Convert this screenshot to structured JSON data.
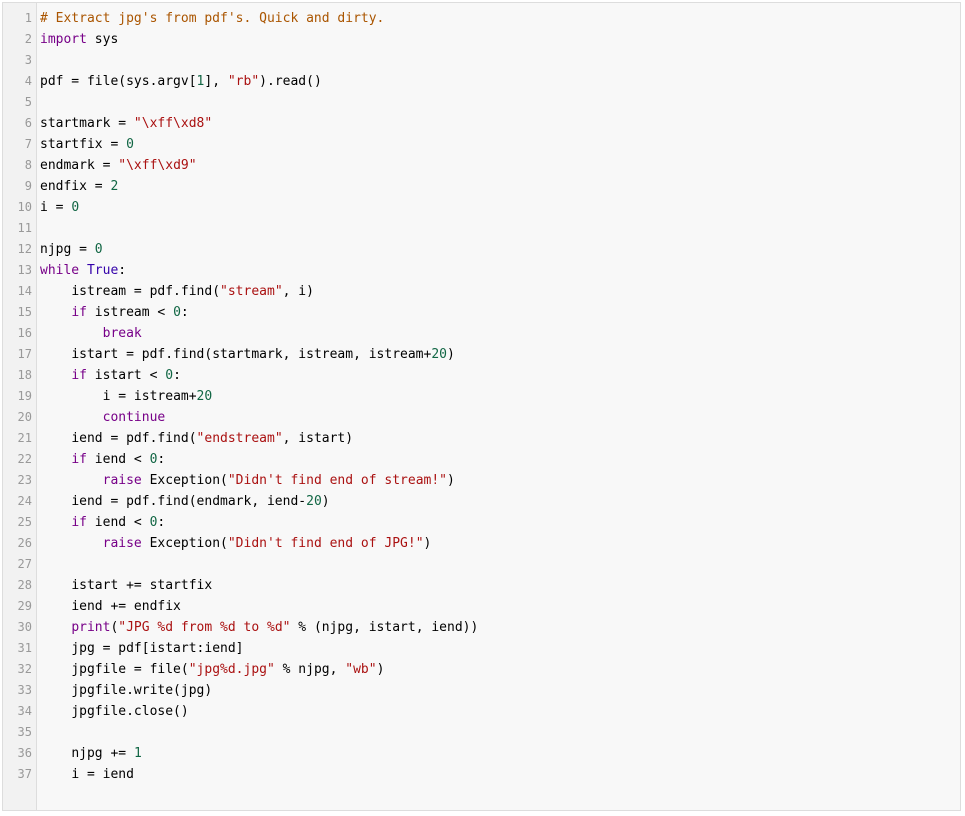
{
  "editor": {
    "colors": {
      "keyword": "#770088",
      "builtin": "#3300aa",
      "string": "#aa1111",
      "number": "#116644",
      "comment": "#aa5500",
      "text": "#000000",
      "line_number": "#999999"
    },
    "lines": [
      {
        "n": "1",
        "tokens": [
          {
            "t": "comment",
            "v": "# Extract jpg's from pdf's. Quick and dirty."
          }
        ]
      },
      {
        "n": "2",
        "tokens": [
          {
            "t": "keyword",
            "v": "import"
          },
          {
            "t": "text",
            "v": " sys"
          }
        ]
      },
      {
        "n": "3",
        "tokens": []
      },
      {
        "n": "4",
        "tokens": [
          {
            "t": "text",
            "v": "pdf = file(sys.argv["
          },
          {
            "t": "number",
            "v": "1"
          },
          {
            "t": "text",
            "v": "], "
          },
          {
            "t": "string",
            "v": "\"rb\""
          },
          {
            "t": "text",
            "v": ").read()"
          }
        ]
      },
      {
        "n": "5",
        "tokens": []
      },
      {
        "n": "6",
        "tokens": [
          {
            "t": "text",
            "v": "startmark = "
          },
          {
            "t": "string",
            "v": "\"\\xff\\xd8\""
          }
        ]
      },
      {
        "n": "7",
        "tokens": [
          {
            "t": "text",
            "v": "startfix = "
          },
          {
            "t": "number",
            "v": "0"
          }
        ]
      },
      {
        "n": "8",
        "tokens": [
          {
            "t": "text",
            "v": "endmark = "
          },
          {
            "t": "string",
            "v": "\"\\xff\\xd9\""
          }
        ]
      },
      {
        "n": "9",
        "tokens": [
          {
            "t": "text",
            "v": "endfix = "
          },
          {
            "t": "number",
            "v": "2"
          }
        ]
      },
      {
        "n": "10",
        "tokens": [
          {
            "t": "text",
            "v": "i = "
          },
          {
            "t": "number",
            "v": "0"
          }
        ]
      },
      {
        "n": "11",
        "tokens": []
      },
      {
        "n": "12",
        "tokens": [
          {
            "t": "text",
            "v": "njpg = "
          },
          {
            "t": "number",
            "v": "0"
          }
        ]
      },
      {
        "n": "13",
        "tokens": [
          {
            "t": "keyword",
            "v": "while"
          },
          {
            "t": "text",
            "v": " "
          },
          {
            "t": "builtin",
            "v": "True"
          },
          {
            "t": "text",
            "v": ":"
          }
        ]
      },
      {
        "n": "14",
        "tokens": [
          {
            "t": "ws",
            "v": "    "
          },
          {
            "t": "text",
            "v": "istream = pdf.find("
          },
          {
            "t": "string",
            "v": "\"stream\""
          },
          {
            "t": "text",
            "v": ", i)"
          }
        ]
      },
      {
        "n": "15",
        "tokens": [
          {
            "t": "ws",
            "v": "    "
          },
          {
            "t": "keyword",
            "v": "if"
          },
          {
            "t": "text",
            "v": " istream < "
          },
          {
            "t": "number",
            "v": "0"
          },
          {
            "t": "text",
            "v": ":"
          }
        ]
      },
      {
        "n": "16",
        "tokens": [
          {
            "t": "ws",
            "v": "        "
          },
          {
            "t": "keyword",
            "v": "break"
          }
        ]
      },
      {
        "n": "17",
        "tokens": [
          {
            "t": "ws",
            "v": "    "
          },
          {
            "t": "text",
            "v": "istart = pdf.find(startmark, istream, istream+"
          },
          {
            "t": "number",
            "v": "20"
          },
          {
            "t": "text",
            "v": ")"
          }
        ]
      },
      {
        "n": "18",
        "tokens": [
          {
            "t": "ws",
            "v": "    "
          },
          {
            "t": "keyword",
            "v": "if"
          },
          {
            "t": "text",
            "v": " istart < "
          },
          {
            "t": "number",
            "v": "0"
          },
          {
            "t": "text",
            "v": ":"
          }
        ]
      },
      {
        "n": "19",
        "tokens": [
          {
            "t": "ws",
            "v": "        "
          },
          {
            "t": "text",
            "v": "i = istream+"
          },
          {
            "t": "number",
            "v": "20"
          }
        ]
      },
      {
        "n": "20",
        "tokens": [
          {
            "t": "ws",
            "v": "        "
          },
          {
            "t": "keyword",
            "v": "continue"
          }
        ]
      },
      {
        "n": "21",
        "tokens": [
          {
            "t": "ws",
            "v": "    "
          },
          {
            "t": "text",
            "v": "iend = pdf.find("
          },
          {
            "t": "string",
            "v": "\"endstream\""
          },
          {
            "t": "text",
            "v": ", istart)"
          }
        ]
      },
      {
        "n": "22",
        "tokens": [
          {
            "t": "ws",
            "v": "    "
          },
          {
            "t": "keyword",
            "v": "if"
          },
          {
            "t": "text",
            "v": " iend < "
          },
          {
            "t": "number",
            "v": "0"
          },
          {
            "t": "text",
            "v": ":"
          }
        ]
      },
      {
        "n": "23",
        "tokens": [
          {
            "t": "ws",
            "v": "        "
          },
          {
            "t": "keyword",
            "v": "raise"
          },
          {
            "t": "text",
            "v": " Exception("
          },
          {
            "t": "string",
            "v": "\"Didn't find end of stream!\""
          },
          {
            "t": "text",
            "v": ")"
          }
        ]
      },
      {
        "n": "24",
        "tokens": [
          {
            "t": "ws",
            "v": "    "
          },
          {
            "t": "text",
            "v": "iend = pdf.find(endmark, iend-"
          },
          {
            "t": "number",
            "v": "20"
          },
          {
            "t": "text",
            "v": ")"
          }
        ]
      },
      {
        "n": "25",
        "tokens": [
          {
            "t": "ws",
            "v": "    "
          },
          {
            "t": "keyword",
            "v": "if"
          },
          {
            "t": "text",
            "v": " iend < "
          },
          {
            "t": "number",
            "v": "0"
          },
          {
            "t": "text",
            "v": ":"
          }
        ]
      },
      {
        "n": "26",
        "tokens": [
          {
            "t": "ws",
            "v": "        "
          },
          {
            "t": "keyword",
            "v": "raise"
          },
          {
            "t": "text",
            "v": " Exception("
          },
          {
            "t": "string",
            "v": "\"Didn't find end of JPG!\""
          },
          {
            "t": "text",
            "v": ")"
          }
        ]
      },
      {
        "n": "27",
        "tokens": []
      },
      {
        "n": "28",
        "tokens": [
          {
            "t": "ws",
            "v": "    "
          },
          {
            "t": "text",
            "v": "istart += startfix"
          }
        ]
      },
      {
        "n": "29",
        "tokens": [
          {
            "t": "ws",
            "v": "    "
          },
          {
            "t": "text",
            "v": "iend += endfix"
          }
        ]
      },
      {
        "n": "30",
        "tokens": [
          {
            "t": "ws",
            "v": "    "
          },
          {
            "t": "keyword",
            "v": "print"
          },
          {
            "t": "text",
            "v": "("
          },
          {
            "t": "string",
            "v": "\"JPG %d from %d to %d\""
          },
          {
            "t": "text",
            "v": " % (njpg, istart, iend))"
          }
        ]
      },
      {
        "n": "31",
        "tokens": [
          {
            "t": "ws",
            "v": "    "
          },
          {
            "t": "text",
            "v": "jpg = pdf[istart:iend]"
          }
        ]
      },
      {
        "n": "32",
        "tokens": [
          {
            "t": "ws",
            "v": "    "
          },
          {
            "t": "text",
            "v": "jpgfile = file("
          },
          {
            "t": "string",
            "v": "\"jpg%d.jpg\""
          },
          {
            "t": "text",
            "v": " % njpg, "
          },
          {
            "t": "string",
            "v": "\"wb\""
          },
          {
            "t": "text",
            "v": ")"
          }
        ]
      },
      {
        "n": "33",
        "tokens": [
          {
            "t": "ws",
            "v": "    "
          },
          {
            "t": "text",
            "v": "jpgfile.write(jpg)"
          }
        ]
      },
      {
        "n": "34",
        "tokens": [
          {
            "t": "ws",
            "v": "    "
          },
          {
            "t": "text",
            "v": "jpgfile.close()"
          }
        ]
      },
      {
        "n": "35",
        "tokens": []
      },
      {
        "n": "36",
        "tokens": [
          {
            "t": "ws",
            "v": "    "
          },
          {
            "t": "text",
            "v": "njpg += "
          },
          {
            "t": "number",
            "v": "1"
          }
        ]
      },
      {
        "n": "37",
        "tokens": [
          {
            "t": "ws",
            "v": "    "
          },
          {
            "t": "text",
            "v": "i = iend"
          }
        ]
      }
    ]
  }
}
